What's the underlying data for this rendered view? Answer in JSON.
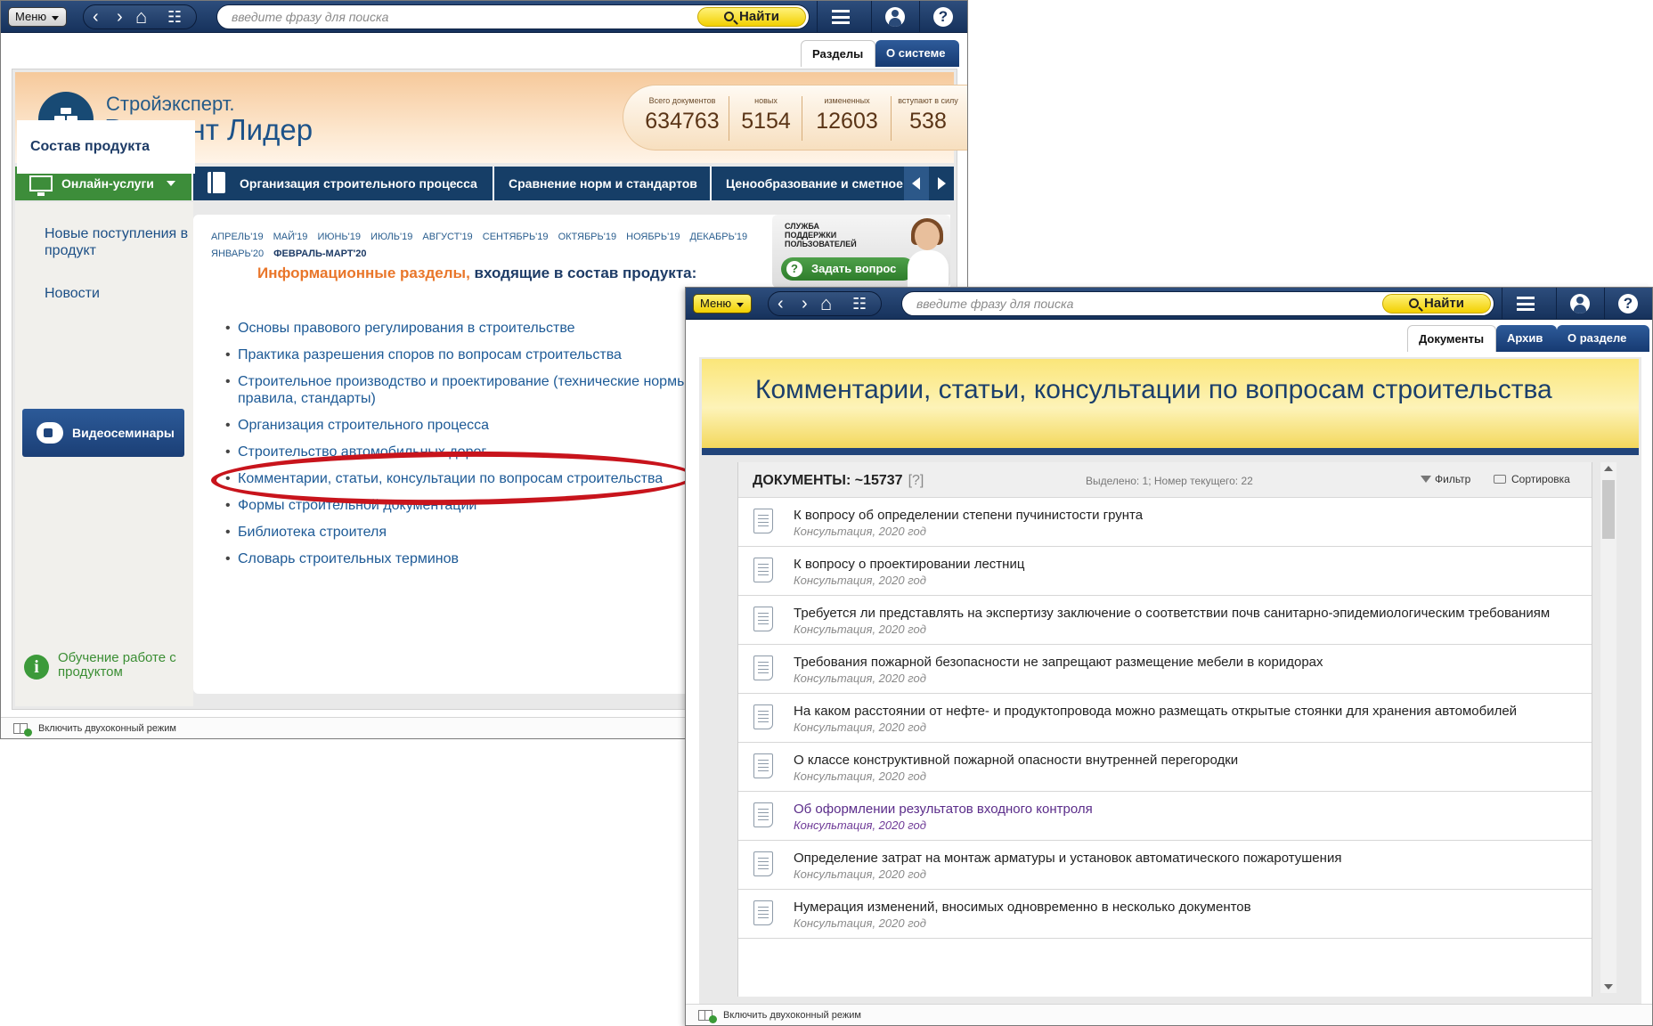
{
  "toolbar": {
    "menu_label": "Меню",
    "search_placeholder": "введите фразу для поиска",
    "find_label": "Найти",
    "help_glyph": "?"
  },
  "window1": {
    "tabs": [
      "Разделы",
      "О системе"
    ],
    "logo": {
      "line1": "Стройэксперт.",
      "line2": "Вариант Лидер"
    },
    "stats": [
      {
        "label": "Всего документов",
        "value": "634763"
      },
      {
        "label": "новых",
        "value": "5154"
      },
      {
        "label": "измененных",
        "value": "12603"
      },
      {
        "label": "вступают в силу",
        "value": "538"
      }
    ],
    "nav": [
      "Онлайн-услуги",
      "Организация строительного процесса",
      "Сравнение норм и стандартов",
      "Ценообразование и сметное"
    ],
    "sidebar": {
      "new_arrivals": "Новые поступления в продукт",
      "news": "Новости",
      "composition": "Состав продукта",
      "video": "Видеосеминары",
      "learning": "Обучение работе с продуктом"
    },
    "months": [
      "АПРЕЛЬ'19",
      "МАЙ'19",
      "ИЮНЬ'19",
      "ИЮЛЬ'19",
      "АВГУСТ'19",
      "СЕНТЯБРЬ'19",
      "ОКТЯБРЬ'19",
      "НОЯБРЬ'19",
      "ДЕКАБРЬ'19",
      "ЯНВАРЬ'20",
      "ФЕВРАЛЬ-МАРТ'20"
    ],
    "info_title_orange": "Информационные разделы,",
    "info_title_blue": " входящие в состав продукта:",
    "sections": [
      "Основы правового регулирования в строительстве",
      "Практика разрешения споров по вопросам строительства",
      "Строительное производство и проектирование (технические нормы, правила, стандарты)",
      "Организация строительного процесса",
      "Строительство автомобильных дорог",
      "Комментарии, статьи, консультации по вопросам строительства",
      "Формы строительной документации",
      "Библиотека строителя",
      "Словарь строительных терминов"
    ],
    "support": {
      "text": "СЛУЖБА ПОДДЕРЖКИ ПОЛЬЗОВАТЕЛЕЙ",
      "button": "Задать вопрос"
    },
    "status": "Включить двухоконный режим"
  },
  "window2": {
    "tabs": [
      "Документы",
      "Архив",
      "О разделе"
    ],
    "title": "Комментарии, статьи, консультации по вопросам строительства",
    "doc_count": "ДОКУМЕНТЫ: ~15737",
    "doc_hint": "[?]",
    "selection": "Выделено: 1; Номер текущего: 22",
    "filter": "Фильтр",
    "sort": "Сортировка",
    "documents": [
      {
        "title": "К вопросу об определении степени пучинистости грунта",
        "sub": "Консультация, 2020 год"
      },
      {
        "title": "К вопросу о проектировании лестниц",
        "sub": "Консультация, 2020 год"
      },
      {
        "title": "Требуется ли представлять на экспертизу заключение о соответствии почв санитарно-эпидемиологическим требованиям",
        "sub": "Консультация, 2020 год"
      },
      {
        "title": "Требования пожарной безопасности не запрещают размещение мебели в коридорах",
        "sub": "Консультация, 2020 год"
      },
      {
        "title": "На каком расстоянии от нефте- и продуктопровода можно размещать открытые стоянки для хранения автомобилей",
        "sub": "Консультация, 2020 год"
      },
      {
        "title": "О классе конструктивной пожарной опасности внутренней перегородки",
        "sub": "Консультация, 2020 год"
      },
      {
        "title": "Об оформлении результатов входного контроля",
        "sub": "Консультация, 2020 год",
        "visited": true
      },
      {
        "title": "Определение затрат на монтаж арматуры и установок автоматического пожаротушения",
        "sub": "Консультация, 2020 год"
      },
      {
        "title": "Нумерация изменений, вносимых одновременно в несколько документов",
        "sub": "Консультация, 2020 год"
      }
    ],
    "status": "Включить двухоконный режим"
  }
}
